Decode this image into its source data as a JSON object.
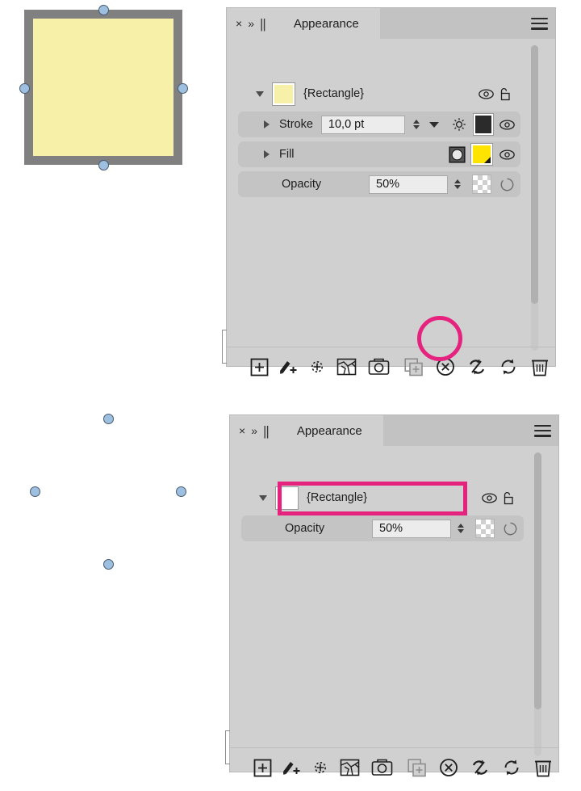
{
  "meta": {
    "app": "Adobe Illustrator",
    "accent_magenta": "#E6227F",
    "panel_bg": "#D0D0D0",
    "row_bg": "#C4C4C4",
    "tabbar_bg": "#C2C2C2",
    "field_bg": "#ECECEC"
  },
  "artwork_top": {
    "name": "rectangle-with-stroke-and-fill",
    "fill_color": "#F7F0A8",
    "stroke_color": "#808080",
    "anchor_color": "#9DBFE0"
  },
  "artwork_bottom": {
    "name": "rectangle-cleared-appearance",
    "fill_color": "none",
    "stroke_color": "none",
    "anchor_color": "#9DBFE0"
  },
  "panel_top": {
    "tab": {
      "close_glyph": "×",
      "collapse_glyph": "»",
      "grip_glyph": "||",
      "title": "Appearance",
      "menu_icon": "hamburger-menu-icon"
    },
    "target_row": {
      "disclosure": "open",
      "thumbnail_color": "#F7F0A8",
      "label": "{Rectangle}",
      "visibility_icon": "eye-icon",
      "lock_icon": "unlocked-padlock-icon"
    },
    "rows": [
      {
        "id": "stroke",
        "disclosure": "closed",
        "label": "Stroke",
        "value": "10,0 pt",
        "has_stepper": true,
        "has_dropdown": true,
        "options_icon": "stroke-options-gear-icon",
        "swatch_color": "#2B2B2B",
        "visibility_icon": "eye-icon"
      },
      {
        "id": "fill",
        "disclosure": "closed",
        "label": "Fill",
        "value": "",
        "has_stepper": false,
        "has_dropdown": false,
        "gradient_icon": "fill-type-circle-icon",
        "swatch_color": "#FFE400",
        "visibility_icon": "eye-icon"
      },
      {
        "id": "opacity",
        "disclosure": "none",
        "label": "Opacity",
        "value": "50%",
        "has_stepper": true,
        "has_dropdown": false,
        "checker_icon": "transparency-checkerboard-icon",
        "knockout_icon": "opacity-knockout-icon"
      }
    ],
    "footer_tools": [
      {
        "name": "add-new-stroke-icon",
        "label": "Add New Stroke"
      },
      {
        "name": "add-new-fill-icon",
        "label": "Add New Fill"
      },
      {
        "name": "add-new-effect-icon",
        "label": "Add New Effect"
      },
      {
        "name": "clear-effects-icon",
        "label": "Clear Effects"
      },
      {
        "name": "new-graphic-style-icon",
        "label": "New Graphic Style"
      },
      {
        "name": "duplicate-item-icon",
        "label": "Duplicate Selected Item"
      },
      {
        "name": "clear-appearance-icon",
        "label": "Clear Appearance"
      },
      {
        "name": "reduce-to-basic-appearance-icon",
        "label": "Reduce to Basic Appearance"
      },
      {
        "name": "redefine-graphic-style-icon",
        "label": "Redefine Graphic Style"
      },
      {
        "name": "delete-item-icon",
        "label": "Delete Selected Item"
      }
    ],
    "annotation": {
      "type": "circle-highlight",
      "targets": "clear-appearance-icon"
    }
  },
  "panel_bottom": {
    "tab": {
      "close_glyph": "×",
      "collapse_glyph": "»",
      "grip_glyph": "||",
      "title": "Appearance",
      "menu_icon": "hamburger-menu-icon"
    },
    "target_row": {
      "disclosure": "open",
      "thumbnail_color": "#FFFFFF",
      "label": "{Rectangle}",
      "visibility_icon": "eye-icon",
      "lock_icon": "unlocked-padlock-icon"
    },
    "rows": [
      {
        "id": "opacity",
        "disclosure": "none",
        "label": "Opacity",
        "value": "50%",
        "has_stepper": true,
        "has_dropdown": false,
        "checker_icon": "transparency-checkerboard-icon",
        "knockout_icon": "opacity-knockout-icon"
      }
    ],
    "footer_tools": [
      {
        "name": "add-new-stroke-icon",
        "label": "Add New Stroke"
      },
      {
        "name": "add-new-fill-icon",
        "label": "Add New Fill"
      },
      {
        "name": "add-new-effect-icon",
        "label": "Add New Effect"
      },
      {
        "name": "clear-effects-icon",
        "label": "Clear Effects"
      },
      {
        "name": "new-graphic-style-icon",
        "label": "New Graphic Style"
      },
      {
        "name": "duplicate-item-icon",
        "label": "Duplicate Selected Item"
      },
      {
        "name": "clear-appearance-icon",
        "label": "Clear Appearance"
      },
      {
        "name": "reduce-to-basic-appearance-icon",
        "label": "Reduce to Basic Appearance"
      },
      {
        "name": "redefine-graphic-style-icon",
        "label": "Redefine Graphic Style"
      },
      {
        "name": "delete-item-icon",
        "label": "Delete Selected Item"
      }
    ],
    "annotation": {
      "type": "rectangle-highlight",
      "targets": "opacity-row"
    }
  }
}
